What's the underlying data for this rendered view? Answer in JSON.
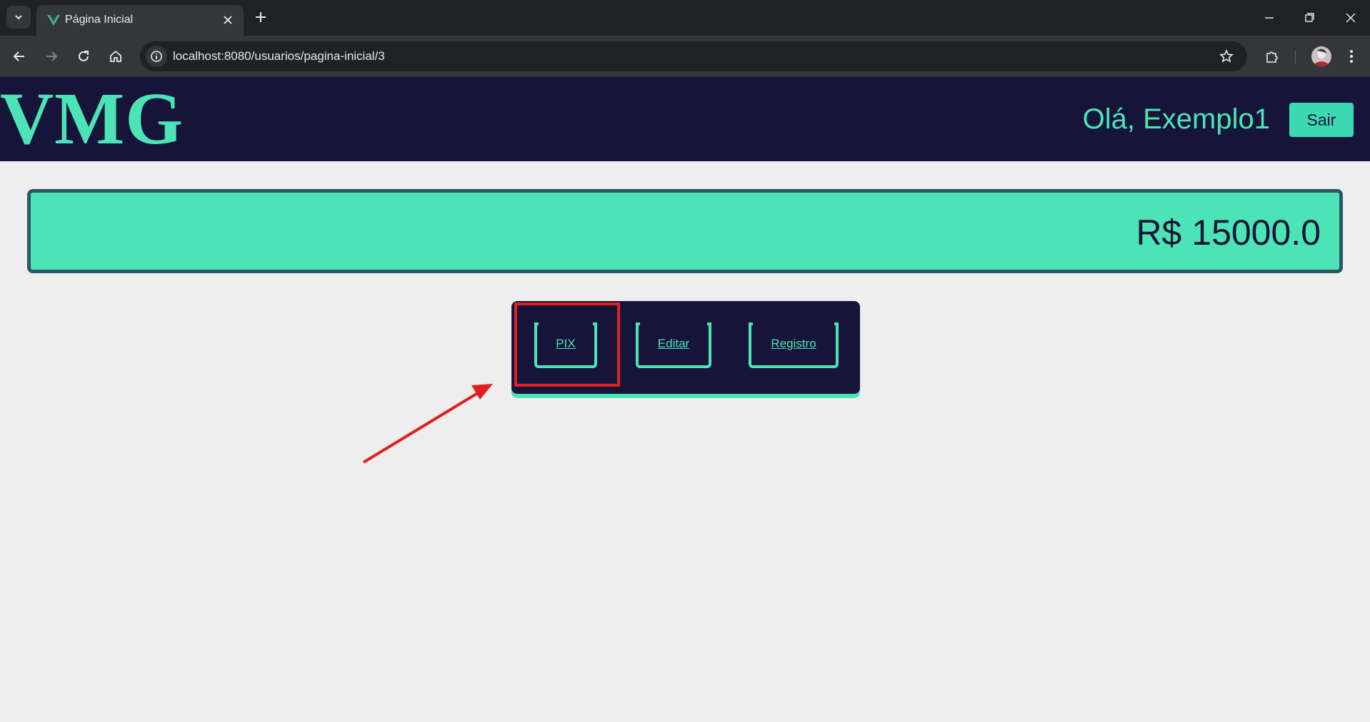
{
  "browser": {
    "tab_title": "Página Inicial",
    "url": "localhost:8080/usuarios/pagina-inicial/3"
  },
  "header": {
    "logo": "VMG",
    "greeting": "Olá, Exemplo1",
    "logout_label": "Sair"
  },
  "account": {
    "balance": "R$ 15000.0"
  },
  "actions": {
    "pix_label": "PIX",
    "edit_label": "Editar",
    "records_label": "Registro"
  },
  "colors": {
    "accent": "#4ce4b7",
    "navy": "#161438",
    "annotation_red": "#e0201f"
  }
}
